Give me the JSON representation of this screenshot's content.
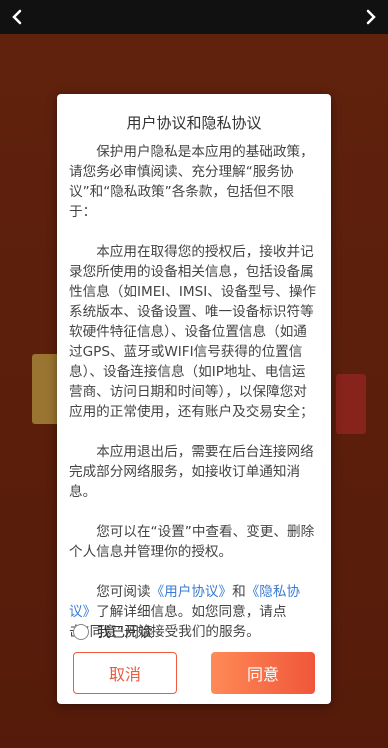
{
  "dialog": {
    "title": "用户协议和隐私协议",
    "p1": "保护用户隐私是本应用的基础政策，请您务必审慎阅读、充分理解“服务协议”和“隐私政策”各条款，包括但不限于：",
    "p2": "本应用在取得您的授权后，接收并记录您所使用的设备相关信息，包括设备属性信息（如IMEI、IMSI、设备型号、操作系统版本、设备设置、唯一设备标识符等软硬件特征信息）、设备位置信息（如通过GPS、蓝牙或WIFI信号获得的位置信息）、设备连接信息（如IP地址、电信运营商、访问日期和时间等），以保障您对应用的正常使用，还有账户及交易安全；",
    "p3": "本应用退出后，需要在后台连接网络完成部分网络服务，如接收订单通知消息。",
    "p4": "您可以在“设置”中查看、变更、删除个人信息并管理你的授权。",
    "p5_prefix": "您可阅读",
    "user_agreement_link": "《用户协议》",
    "and": "和",
    "privacy_link": "《隐私协议》",
    "p5_suffix": "了解详细信息。如您同意，请点击“同意”开始接受我们的服务。",
    "agree_label": "我已阅读",
    "cancel_label": "取消",
    "ok_label": "同意"
  },
  "colors": {
    "accent": "#f05a3c",
    "link": "#3a7bd5"
  }
}
